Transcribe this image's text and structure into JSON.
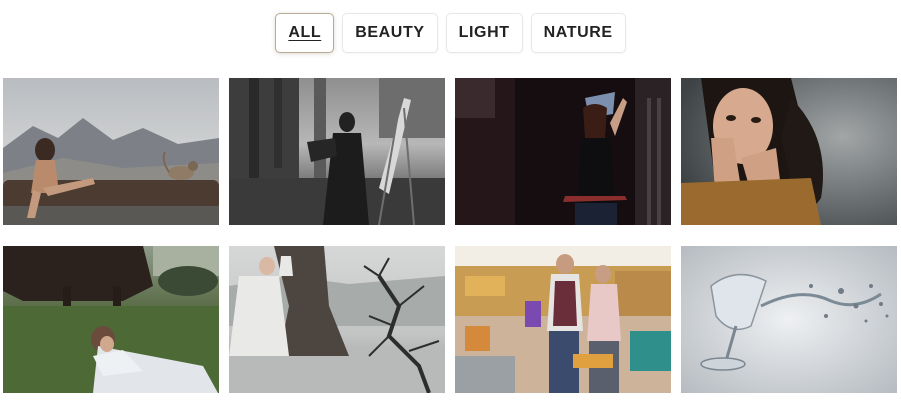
{
  "filters": {
    "items": [
      {
        "label": "ALL",
        "active": true
      },
      {
        "label": "BEAUTY",
        "active": false
      },
      {
        "label": "LIGHT",
        "active": false
      },
      {
        "label": "NATURE",
        "active": false
      }
    ]
  },
  "gallery": {
    "items": [
      {
        "name": "woman-on-log-with-cat-photo"
      },
      {
        "name": "woman-painting-at-easel-photo"
      },
      {
        "name": "woman-in-dark-alley-photo"
      },
      {
        "name": "woman-portrait-hands-photo"
      },
      {
        "name": "woman-lying-in-grass-photo"
      },
      {
        "name": "bride-by-misty-tree-photo"
      },
      {
        "name": "women-shopping-mall-photo"
      },
      {
        "name": "wine-glass-splash-photo"
      }
    ]
  }
}
